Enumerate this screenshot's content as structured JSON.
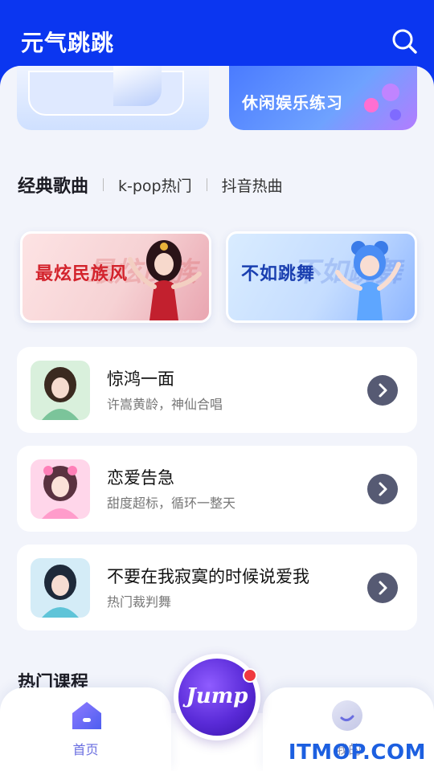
{
  "app": {
    "title": "元气跳跳"
  },
  "header": {
    "search_icon": "search-icon"
  },
  "top_banners": [
    {
      "label": ""
    },
    {
      "label": "休闲娱乐练习"
    }
  ],
  "tabs": [
    {
      "label": "经典歌曲",
      "active": true
    },
    {
      "label": "k-pop热门",
      "active": false
    },
    {
      "label": "抖音热曲",
      "active": false
    }
  ],
  "features": [
    {
      "title": "最炫民族风",
      "watermark": "最炫民族"
    },
    {
      "title": "不如跳舞",
      "watermark": "不如跳舞"
    }
  ],
  "songs": [
    {
      "title": "惊鸿一面",
      "subtitle": "许嵩黄龄，神仙合唱"
    },
    {
      "title": "恋爱告急",
      "subtitle": "甜度超标，循环一整天"
    },
    {
      "title": "不要在我寂寞的时候说爱我",
      "subtitle": "热门裁判舞"
    }
  ],
  "section": {
    "title": "热门课程"
  },
  "bottom_nav": {
    "home_label": "首页",
    "center_label": "Jump",
    "me_label": "我的"
  },
  "watermark": "ITMOP.COM",
  "colors": {
    "brand": "#0b36f0",
    "background": "#f2f4fb",
    "accent": "#6a6ee0",
    "badge": "#f0383f"
  }
}
